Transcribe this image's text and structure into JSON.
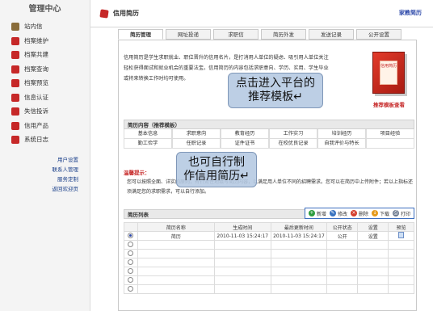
{
  "sidebar": {
    "title": "管理中心",
    "items": [
      {
        "label": "站内信",
        "icon": "mail-icon",
        "color": "#8a6d3b"
      },
      {
        "label": "档案维护",
        "icon": "folder-icon",
        "color": "#c62828"
      },
      {
        "label": "档案共建",
        "icon": "share-icon",
        "color": "#c62828"
      },
      {
        "label": "档案查询",
        "icon": "search-doc-icon",
        "color": "#c62828"
      },
      {
        "label": "档案预览",
        "icon": "preview-icon",
        "color": "#c62828"
      },
      {
        "label": "信息认证",
        "icon": "certify-icon",
        "color": "#c62828"
      },
      {
        "label": "失信投诉",
        "icon": "complaint-icon",
        "color": "#c62828"
      },
      {
        "label": "信用产品",
        "icon": "product-icon",
        "color": "#c62828"
      },
      {
        "label": "系统日志",
        "icon": "log-icon",
        "color": "#c62828"
      }
    ],
    "sub_links": [
      "用户设置",
      "联系人管理",
      "服务定制",
      "返回欢迎页"
    ]
  },
  "header": {
    "title": "信用简历",
    "brand_link": "家教简历"
  },
  "tabs": [
    {
      "label": "简历管理",
      "active": true
    },
    {
      "label": "网址投递",
      "active": false
    },
    {
      "label": "求职信",
      "active": false
    },
    {
      "label": "简历外发",
      "active": false
    },
    {
      "label": "发送记录",
      "active": false
    },
    {
      "label": "公开设置",
      "active": false
    }
  ],
  "intro": {
    "text": "信用简历是学生求职就业、职位晋升的信用名片，是打消用人单位的疑虑、吸引用人单位关注轻松获得面试和就业机会的重要法宝。信用简历的内容包括求职意向、学历、实用、学生毕业或将来转换工作时均可使用。",
    "book_label": "信用简历",
    "template_link": "推荐模板查看"
  },
  "resume_content": {
    "header": "简历内容（推荐模板）",
    "rows": [
      [
        "基本信息",
        "求职意向",
        "教育经历",
        "工作实习",
        "培训经历",
        "项目经验"
      ],
      [
        "勤工俭学",
        "任职记录",
        "证件证书",
        "在校优良记录",
        "自我评价与特长",
        ""
      ]
    ]
  },
  "tips": {
    "title": "温馨提示：",
    "text": "您可以按照全面、详实的原则，有针对性地填写简历内容，以满足用人单位不同的招聘需求。您可以在简历中上传附件；若以上指标还须满足您的求职需求，可以自行添加。"
  },
  "list": {
    "header": "简历列表",
    "toolbar": [
      {
        "label": "新增",
        "icon": "add-icon",
        "color": "#2e9d3f",
        "glyph": "+"
      },
      {
        "label": "修改",
        "icon": "edit-icon",
        "color": "#3a74c0",
        "glyph": "✎"
      },
      {
        "label": "删除",
        "icon": "delete-icon",
        "color": "#d43f2f",
        "glyph": "×"
      },
      {
        "label": "下载",
        "icon": "download-icon",
        "color": "#e59a1b",
        "glyph": "↓"
      },
      {
        "label": "打印",
        "icon": "print-icon",
        "color": "#6c7a8f",
        "glyph": "⎙"
      }
    ],
    "columns": [
      "",
      "简历名称",
      "生成时间",
      "最后更新时间",
      "公开状态",
      "设置",
      "预览"
    ],
    "rows": [
      {
        "name": "简历",
        "created": "2010-11-03 15:24:17",
        "updated": "2010-11-03 15:24:17",
        "status": "公开",
        "setting": "设置"
      }
    ],
    "empty_rows": 6
  },
  "callouts": {
    "template": "点击进入平台的推荐模板↵",
    "create": "也可自行制作信用简历↵"
  }
}
